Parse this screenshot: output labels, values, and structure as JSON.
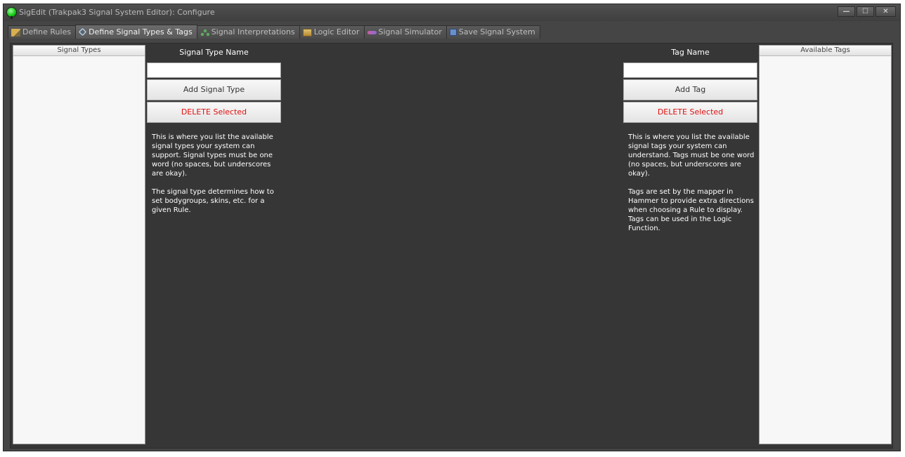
{
  "window": {
    "title": "SigEdit (Trakpak3 Signal System Editor): Configure",
    "controls": {
      "minimize": "—",
      "maximize": "☐",
      "close": "✕"
    }
  },
  "tabs": [
    {
      "label": "Define Rules",
      "icon": "pencil-icon",
      "active": false
    },
    {
      "label": "Define Signal Types & Tags",
      "icon": "tag-icon",
      "active": true
    },
    {
      "label": "Signal Interpretations",
      "icon": "tree-icon",
      "active": false
    },
    {
      "label": "Logic Editor",
      "icon": "monitor-icon",
      "active": false
    },
    {
      "label": "Signal Simulator",
      "icon": "wave-icon",
      "active": false
    },
    {
      "label": "Save Signal System",
      "icon": "disk-icon",
      "active": false
    }
  ],
  "signal_types": {
    "list_header": "Signal Types",
    "name_label": "Signal Type Name",
    "name_value": "",
    "add_button": "Add Signal Type",
    "delete_button": "DELETE Selected",
    "desc_1": "This is where you list the available signal types your system can support. Signal types must be one word (no spaces, but underscores are okay).",
    "desc_2": "The signal type determines how to set bodygroups, skins, etc. for a given Rule."
  },
  "tags": {
    "list_header": "Available Tags",
    "name_label": "Tag Name",
    "name_value": "",
    "add_button": "Add Tag",
    "delete_button": "DELETE Selected",
    "desc_1": "This is where you list the available signal tags your system can understand. Tags must be one word (no spaces, but underscores are okay).",
    "desc_2": "Tags are set by the mapper in Hammer to provide extra directions when choosing a Rule to display. Tags can be used in the Logic Function."
  },
  "colors": {
    "delete_text": "#e01010",
    "panel_bg": "#363636",
    "app_icon": "#12c412"
  }
}
